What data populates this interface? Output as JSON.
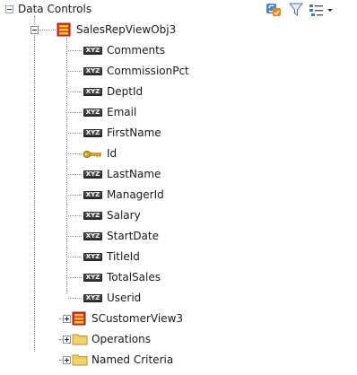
{
  "panel": {
    "title": "Data Controls",
    "toolbar_icons": [
      "refresh-icon",
      "filter-icon",
      "view-options-icon"
    ]
  },
  "colors": {
    "collection_icon_red": "#d9352b",
    "collection_icon_yellow": "#f2c230",
    "folder_yellow": "#f3d36e",
    "attribute_badge": "#3a3a3a",
    "key_gold": "#d9a21b"
  },
  "tree": {
    "root": {
      "label": "SalesRepViewObj3",
      "icon": "collection-icon",
      "expanded": true
    },
    "attributes": [
      {
        "label": "Comments",
        "icon": "attribute-icon",
        "badge": "XYZ"
      },
      {
        "label": "CommissionPct",
        "icon": "attribute-icon",
        "badge": "XYZ"
      },
      {
        "label": "DeptId",
        "icon": "attribute-icon",
        "badge": "XYZ"
      },
      {
        "label": "Email",
        "icon": "attribute-icon",
        "badge": "XYZ"
      },
      {
        "label": "FirstName",
        "icon": "attribute-icon",
        "badge": "XYZ"
      },
      {
        "label": "Id",
        "icon": "key-icon",
        "badge": ""
      },
      {
        "label": "LastName",
        "icon": "attribute-icon",
        "badge": "XYZ"
      },
      {
        "label": "ManagerId",
        "icon": "attribute-icon",
        "badge": "XYZ"
      },
      {
        "label": "Salary",
        "icon": "attribute-icon",
        "badge": "XYZ"
      },
      {
        "label": "StartDate",
        "icon": "attribute-icon",
        "badge": "XYZ"
      },
      {
        "label": "TitleId",
        "icon": "attribute-icon",
        "badge": "XYZ"
      },
      {
        "label": "TotalSales",
        "icon": "attribute-icon",
        "badge": "XYZ"
      },
      {
        "label": "Userid",
        "icon": "attribute-icon",
        "badge": "XYZ"
      }
    ],
    "children": [
      {
        "label": "SCustomerView3",
        "icon": "collection-icon",
        "expanded": false
      },
      {
        "label": "Operations",
        "icon": "folder-icon",
        "expanded": false
      },
      {
        "label": "Named Criteria",
        "icon": "folder-icon",
        "expanded": false
      }
    ]
  }
}
